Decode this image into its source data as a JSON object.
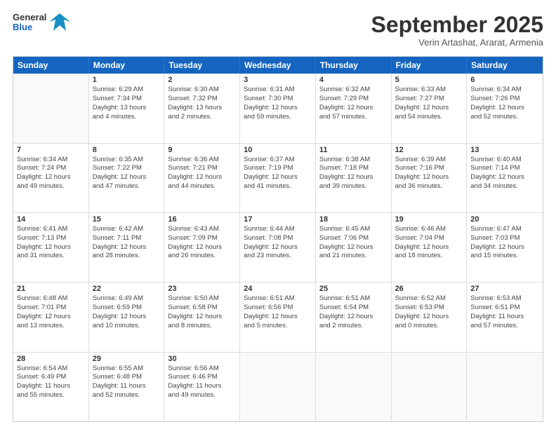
{
  "logo": {
    "general": "General",
    "blue": "Blue"
  },
  "title": "September 2025",
  "subtitle": "Verin Artashat, Ararat, Armenia",
  "days_of_week": [
    "Sunday",
    "Monday",
    "Tuesday",
    "Wednesday",
    "Thursday",
    "Friday",
    "Saturday"
  ],
  "weeks": [
    [
      {
        "day": "",
        "lines": []
      },
      {
        "day": "1",
        "lines": [
          "Sunrise: 6:29 AM",
          "Sunset: 7:34 PM",
          "Daylight: 13 hours",
          "and 4 minutes."
        ]
      },
      {
        "day": "2",
        "lines": [
          "Sunrise: 6:30 AM",
          "Sunset: 7:32 PM",
          "Daylight: 13 hours",
          "and 2 minutes."
        ]
      },
      {
        "day": "3",
        "lines": [
          "Sunrise: 6:31 AM",
          "Sunset: 7:30 PM",
          "Daylight: 12 hours",
          "and 59 minutes."
        ]
      },
      {
        "day": "4",
        "lines": [
          "Sunrise: 6:32 AM",
          "Sunset: 7:29 PM",
          "Daylight: 12 hours",
          "and 57 minutes."
        ]
      },
      {
        "day": "5",
        "lines": [
          "Sunrise: 6:33 AM",
          "Sunset: 7:27 PM",
          "Daylight: 12 hours",
          "and 54 minutes."
        ]
      },
      {
        "day": "6",
        "lines": [
          "Sunrise: 6:34 AM",
          "Sunset: 7:26 PM",
          "Daylight: 12 hours",
          "and 52 minutes."
        ]
      }
    ],
    [
      {
        "day": "7",
        "lines": [
          "Sunrise: 6:34 AM",
          "Sunset: 7:24 PM",
          "Daylight: 12 hours",
          "and 49 minutes."
        ]
      },
      {
        "day": "8",
        "lines": [
          "Sunrise: 6:35 AM",
          "Sunset: 7:22 PM",
          "Daylight: 12 hours",
          "and 47 minutes."
        ]
      },
      {
        "day": "9",
        "lines": [
          "Sunrise: 6:36 AM",
          "Sunset: 7:21 PM",
          "Daylight: 12 hours",
          "and 44 minutes."
        ]
      },
      {
        "day": "10",
        "lines": [
          "Sunrise: 6:37 AM",
          "Sunset: 7:19 PM",
          "Daylight: 12 hours",
          "and 41 minutes."
        ]
      },
      {
        "day": "11",
        "lines": [
          "Sunrise: 6:38 AM",
          "Sunset: 7:18 PM",
          "Daylight: 12 hours",
          "and 39 minutes."
        ]
      },
      {
        "day": "12",
        "lines": [
          "Sunrise: 6:39 AM",
          "Sunset: 7:16 PM",
          "Daylight: 12 hours",
          "and 36 minutes."
        ]
      },
      {
        "day": "13",
        "lines": [
          "Sunrise: 6:40 AM",
          "Sunset: 7:14 PM",
          "Daylight: 12 hours",
          "and 34 minutes."
        ]
      }
    ],
    [
      {
        "day": "14",
        "lines": [
          "Sunrise: 6:41 AM",
          "Sunset: 7:13 PM",
          "Daylight: 12 hours",
          "and 31 minutes."
        ]
      },
      {
        "day": "15",
        "lines": [
          "Sunrise: 6:42 AM",
          "Sunset: 7:11 PM",
          "Daylight: 12 hours",
          "and 28 minutes."
        ]
      },
      {
        "day": "16",
        "lines": [
          "Sunrise: 6:43 AM",
          "Sunset: 7:09 PM",
          "Daylight: 12 hours",
          "and 26 minutes."
        ]
      },
      {
        "day": "17",
        "lines": [
          "Sunrise: 6:44 AM",
          "Sunset: 7:08 PM",
          "Daylight: 12 hours",
          "and 23 minutes."
        ]
      },
      {
        "day": "18",
        "lines": [
          "Sunrise: 6:45 AM",
          "Sunset: 7:06 PM",
          "Daylight: 12 hours",
          "and 21 minutes."
        ]
      },
      {
        "day": "19",
        "lines": [
          "Sunrise: 6:46 AM",
          "Sunset: 7:04 PM",
          "Daylight: 12 hours",
          "and 18 minutes."
        ]
      },
      {
        "day": "20",
        "lines": [
          "Sunrise: 6:47 AM",
          "Sunset: 7:03 PM",
          "Daylight: 12 hours",
          "and 15 minutes."
        ]
      }
    ],
    [
      {
        "day": "21",
        "lines": [
          "Sunrise: 6:48 AM",
          "Sunset: 7:01 PM",
          "Daylight: 12 hours",
          "and 13 minutes."
        ]
      },
      {
        "day": "22",
        "lines": [
          "Sunrise: 6:49 AM",
          "Sunset: 6:59 PM",
          "Daylight: 12 hours",
          "and 10 minutes."
        ]
      },
      {
        "day": "23",
        "lines": [
          "Sunrise: 6:50 AM",
          "Sunset: 6:58 PM",
          "Daylight: 12 hours",
          "and 8 minutes."
        ]
      },
      {
        "day": "24",
        "lines": [
          "Sunrise: 6:51 AM",
          "Sunset: 6:56 PM",
          "Daylight: 12 hours",
          "and 5 minutes."
        ]
      },
      {
        "day": "25",
        "lines": [
          "Sunrise: 6:51 AM",
          "Sunset: 6:54 PM",
          "Daylight: 12 hours",
          "and 2 minutes."
        ]
      },
      {
        "day": "26",
        "lines": [
          "Sunrise: 6:52 AM",
          "Sunset: 6:53 PM",
          "Daylight: 12 hours",
          "and 0 minutes."
        ]
      },
      {
        "day": "27",
        "lines": [
          "Sunrise: 6:53 AM",
          "Sunset: 6:51 PM",
          "Daylight: 11 hours",
          "and 57 minutes."
        ]
      }
    ],
    [
      {
        "day": "28",
        "lines": [
          "Sunrise: 6:54 AM",
          "Sunset: 6:49 PM",
          "Daylight: 11 hours",
          "and 55 minutes."
        ]
      },
      {
        "day": "29",
        "lines": [
          "Sunrise: 6:55 AM",
          "Sunset: 6:48 PM",
          "Daylight: 11 hours",
          "and 52 minutes."
        ]
      },
      {
        "day": "30",
        "lines": [
          "Sunrise: 6:56 AM",
          "Sunset: 6:46 PM",
          "Daylight: 11 hours",
          "and 49 minutes."
        ]
      },
      {
        "day": "",
        "lines": []
      },
      {
        "day": "",
        "lines": []
      },
      {
        "day": "",
        "lines": []
      },
      {
        "day": "",
        "lines": []
      }
    ]
  ]
}
